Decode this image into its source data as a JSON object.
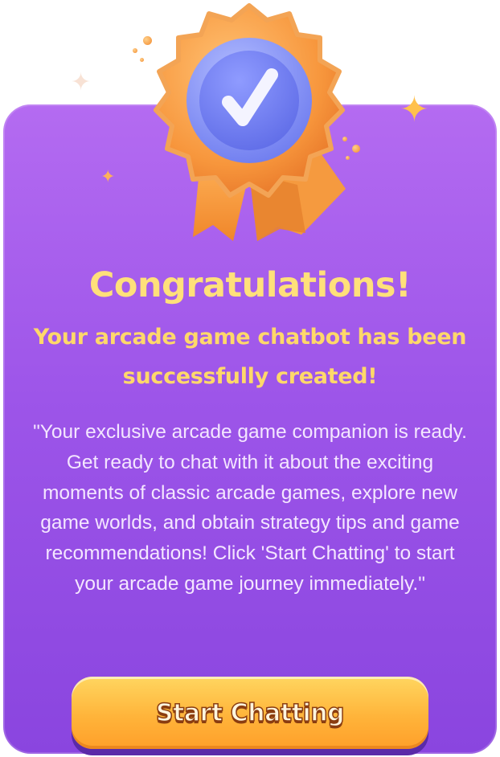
{
  "dialog": {
    "title": "Congratulations!",
    "subtitle": "Your arcade game chatbot has been successfully created!",
    "description": "\"Your exclusive arcade game companion is ready. Get ready to chat with it about the exciting moments of classic arcade games, explore new game worlds, and obtain strategy tips and game recommendations! Click 'Start Chatting' to start your arcade game journey immediately.\"",
    "button_label": "Start Chatting"
  },
  "icons": {
    "badge": "check-medal-icon",
    "sparkle": "sparkle-icon"
  },
  "colors": {
    "card_top": "#b46bf1",
    "card_bottom": "#8a45df",
    "title": "#ffe07a",
    "button": "#ffb43a",
    "badge_rosette": "#f7933a",
    "badge_center": "#7f8cf5"
  }
}
